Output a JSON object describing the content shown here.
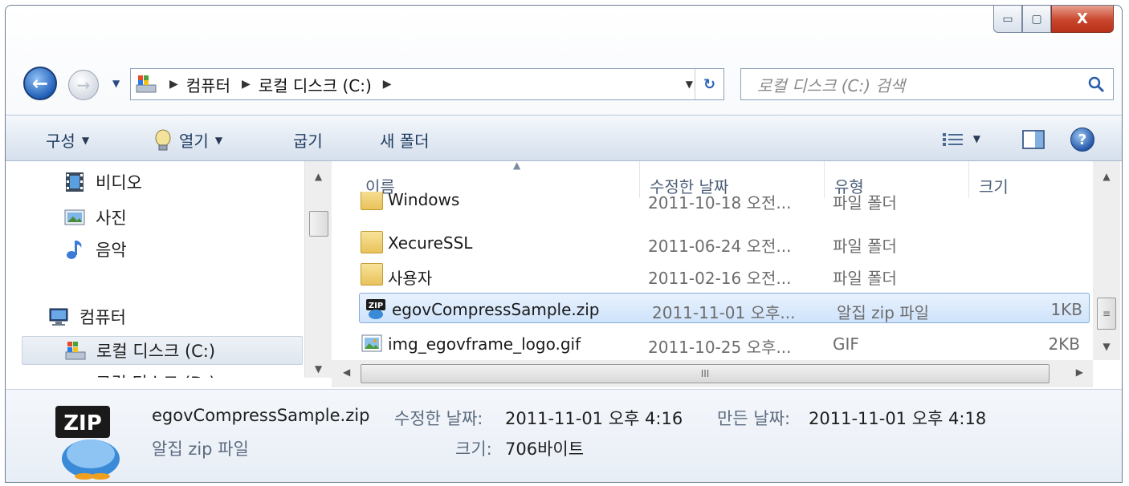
{
  "window": {
    "caption_buttons": {
      "minimize": "▭",
      "maximize": "▢",
      "close": "X"
    }
  },
  "address": {
    "crumbs": [
      "컴퓨터",
      "로컬 디스크 (C:)"
    ],
    "search_placeholder": "로컬 디스크 (C:) 검색"
  },
  "toolbar": {
    "organize": "구성",
    "open": "열기",
    "burn": "굽기",
    "new_folder": "새 폴더"
  },
  "nav": {
    "items": [
      {
        "label": "비디오",
        "icon": "video-icon"
      },
      {
        "label": "사진",
        "icon": "picture-icon"
      },
      {
        "label": "음악",
        "icon": "music-icon"
      },
      {
        "label": "컴퓨터",
        "icon": "computer-icon"
      },
      {
        "label": "로컬 디스크 (C:)",
        "icon": "drive-icon",
        "selected": true
      },
      {
        "label": "로컬 디스크 (D:)",
        "icon": "drive-icon"
      }
    ]
  },
  "columns": {
    "name": "이름",
    "date": "수정한 날짜",
    "type": "유형",
    "size": "크기"
  },
  "files": [
    {
      "name": "Windows",
      "date": "2011-10-18 오전...",
      "type": "파일 폴더",
      "size": "",
      "icon": "folder-icon"
    },
    {
      "name": "XecureSSL",
      "date": "2011-06-24 오전...",
      "type": "파일 폴더",
      "size": "",
      "icon": "folder-icon"
    },
    {
      "name": "사용자",
      "date": "2011-02-16 오전...",
      "type": "파일 폴더",
      "size": "",
      "icon": "folder-icon"
    },
    {
      "name": "egovCompressSample.zip",
      "date": "2011-11-01 오후...",
      "type": "알집 zip 파일",
      "size": "1KB",
      "icon": "zip-icon",
      "selected": true
    },
    {
      "name": "img_egovframe_logo.gif",
      "date": "2011-10-25 오후...",
      "type": "GIF",
      "size": "2KB",
      "icon": "image-file-icon"
    }
  ],
  "scroll": {
    "h_thumb_grip": "III",
    "v_thumb_grip": "≡"
  },
  "details": {
    "filename": "egovCompressSample.zip",
    "filetype": "알집 zip 파일",
    "modified_label": "수정한 날짜:",
    "modified_value": "2011-11-01 오후 4:16",
    "created_label": "만든 날짜:",
    "created_value": "2011-11-01 오후 4:18",
    "size_label": "크기:",
    "size_value": "706바이트",
    "icon_text": "ZIP"
  }
}
